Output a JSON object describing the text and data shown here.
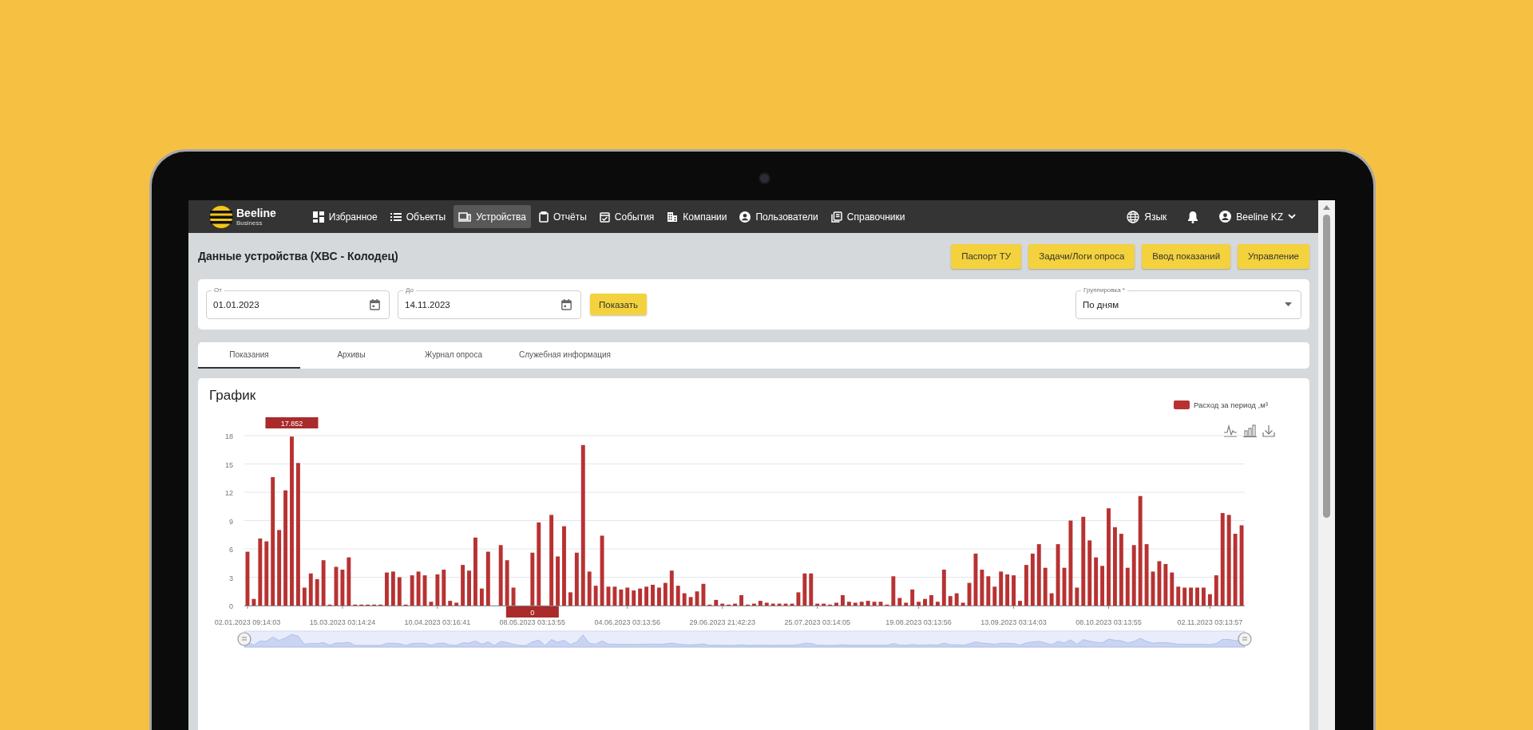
{
  "nav": {
    "logo": {
      "name": "Beeline",
      "sub": "Business"
    },
    "items": [
      {
        "label": "Избранное",
        "selected": false
      },
      {
        "label": "Объекты",
        "selected": false
      },
      {
        "label": "Устройства",
        "selected": true
      },
      {
        "label": "Отчёты",
        "selected": false
      },
      {
        "label": "События",
        "selected": false
      },
      {
        "label": "Компании",
        "selected": false
      },
      {
        "label": "Пользователи",
        "selected": false
      },
      {
        "label": "Справочники",
        "selected": false
      }
    ],
    "language": "Язык",
    "user": "Beeline KZ"
  },
  "page": {
    "title": "Данные устройства (ХВС - Колодец)",
    "actions": [
      "Паспорт ТУ",
      "Задачи/Логи опроса",
      "Ввод показаний",
      "Управление"
    ]
  },
  "filter": {
    "from": {
      "label": "От",
      "value": "01.01.2023"
    },
    "to": {
      "label": "До",
      "value": "14.11.2023"
    },
    "show_button": "Показать",
    "grouping": {
      "label": "Группировка *",
      "value": "По дням"
    }
  },
  "tabs": [
    {
      "label": "Показания",
      "selected": true
    },
    {
      "label": "Архивы",
      "selected": false
    },
    {
      "label": "Журнал опроса",
      "selected": false
    },
    {
      "label": "Служебная информация",
      "selected": false
    }
  ],
  "chart_panel": {
    "title": "График",
    "x_axis_labels": [
      "02.01.2023 09:14:03",
      "15.03.2023 03:14:24",
      "10.04.2023 03:16:41",
      "08.05.2023 03:13:55",
      "04.06.2023 03:13:56",
      "29.06.2023 21:42:23",
      "25.07.2023 03:14:05",
      "19.08.2023 03:13:56",
      "13.09.2023 03:14:03",
      "08.10.2023 03:13:55",
      "02.11.2023 03:13:57"
    ],
    "pointer_labels": [
      "17.852",
      "0"
    ],
    "chart_data": {
      "type": "bar",
      "grid": true,
      "ylim": [
        0,
        18
      ],
      "yticks": [
        0,
        3,
        6,
        9,
        12,
        15,
        18
      ],
      "series": [
        {
          "name": "Расход за период ,м³",
          "color": "#b83232",
          "values": [
            5.7,
            0.7,
            7.1,
            6.8,
            13.6,
            8.0,
            12.2,
            17.9,
            15.1,
            1.9,
            3.4,
            2.8,
            4.8,
            0.1,
            4.1,
            3.8,
            5.1,
            0.1,
            0.1,
            0.1,
            0.1,
            0.1,
            3.5,
            3.6,
            3.0,
            0.1,
            3.2,
            3.6,
            3.2,
            0.4,
            3.3,
            3.8,
            0.5,
            0.3,
            4.3,
            3.7,
            7.2,
            1.8,
            5.7,
            0,
            6.4,
            4.8,
            1.9,
            0,
            0,
            5.6,
            8.8,
            0,
            9.6,
            5.2,
            8.4,
            1.4,
            5.6,
            17.0,
            3.6,
            2.1,
            7.4,
            2.0,
            2.0,
            1.7,
            1.9,
            1.6,
            1.8,
            2.0,
            2.2,
            1.9,
            2.4,
            3.7,
            2.1,
            1.3,
            0.9,
            1.5,
            2.3,
            0.1,
            0.6,
            0.2,
            0.1,
            0.2,
            1.1,
            0.1,
            0.2,
            0.5,
            0.3,
            0.2,
            0.2,
            0.2,
            0.2,
            1.4,
            3.4,
            3.4,
            0.2,
            0.2,
            0.1,
            0.3,
            1.1,
            0.4,
            0.3,
            0.4,
            0.5,
            0.4,
            0.4,
            0.1,
            3.1,
            0.8,
            0.3,
            1.7,
            0.4,
            0.7,
            1.1,
            0.4,
            3.8,
            1.0,
            1.3,
            0.3,
            2.4,
            5.5,
            3.8,
            3.1,
            2.0,
            3.6,
            3.3,
            3.2,
            0.5,
            4.3,
            5.5,
            6.5,
            4.0,
            1.3,
            6.5,
            4.0,
            9.0,
            1.9,
            9.4,
            6.9,
            5.1,
            4.2,
            10.3,
            8.3,
            7.6,
            4.0,
            6.4,
            11.6,
            6.5,
            3.6,
            4.7,
            4.4,
            3.5,
            2.0,
            1.9,
            1.9,
            1.9,
            1.9,
            1.2,
            3.2,
            9.8,
            9.6,
            7.6,
            8.5
          ]
        }
      ]
    }
  }
}
